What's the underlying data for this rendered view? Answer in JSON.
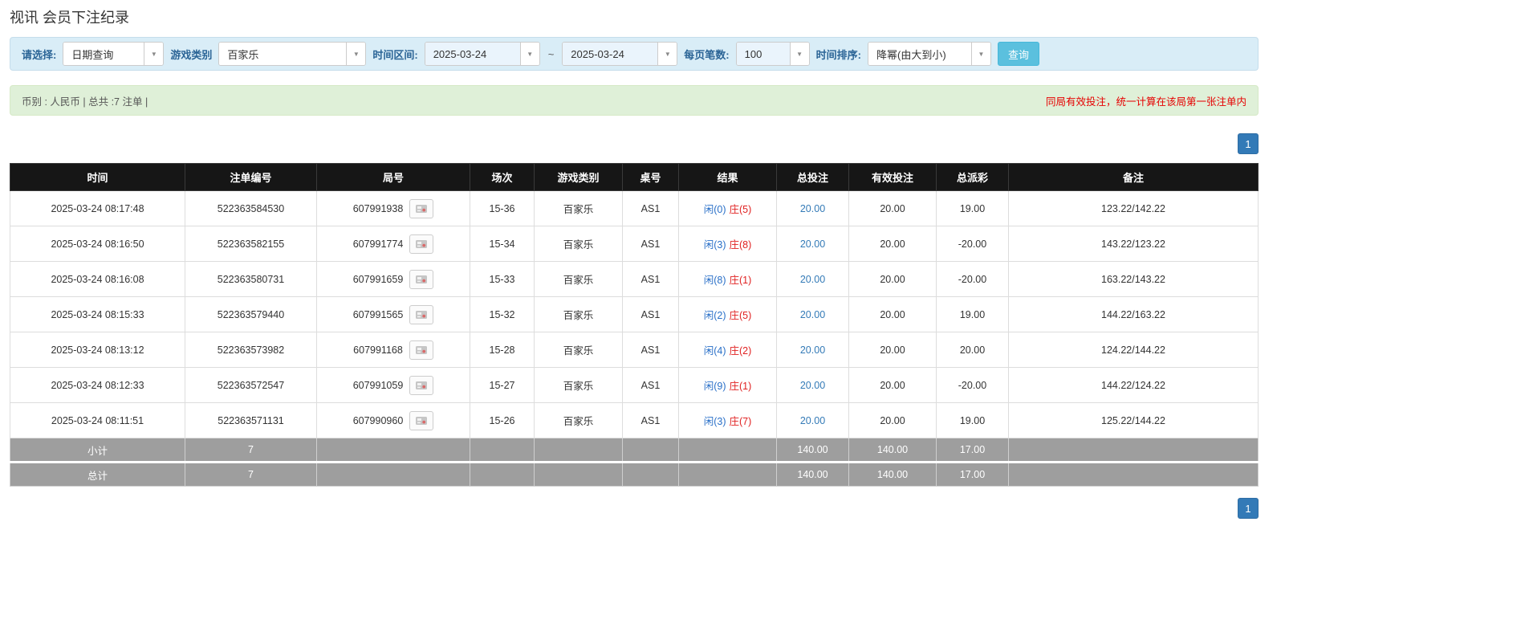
{
  "page": {
    "title": "视讯 会员下注纪录"
  },
  "colors": {
    "accent": "#337ab7",
    "query-button": "#5bc0de",
    "header-bg": "#161616",
    "summary-bg": "#9e9e9e",
    "filter-bg": "#d9edf7",
    "info-bg": "#dff0d8",
    "negative-red": "#e02020",
    "banker-red": "#e02020",
    "player-blue": "#2a70c8",
    "label-blue": "#2a6496",
    "notice-red": "#e60000"
  },
  "icons": {
    "dropdown_caret": "▼"
  },
  "filters": {
    "select_type": {
      "label": "请选择:",
      "value": "日期查询"
    },
    "game_type": {
      "label": "游戏类别",
      "value": "百家乐"
    },
    "date_range": {
      "label": "时间区间:",
      "from": "2025-03-24",
      "separator": "~",
      "to": "2025-03-24"
    },
    "page_size": {
      "label": "每页笔数:",
      "value": "100"
    },
    "sort": {
      "label": "时间排序:",
      "value": "降幂(由大到小)"
    },
    "query_button": "查询"
  },
  "info_bar": {
    "left": "币别 : 人民币 | 总共 :7 注单 |",
    "right": "同局有效投注，统一计算在该局第一张注单内"
  },
  "pagination": {
    "page": "1"
  },
  "table": {
    "headers": [
      "时间",
      "注单编号",
      "局号",
      "场次",
      "游戏类别",
      "桌号",
      "结果",
      "总投注",
      "有效投注",
      "总派彩",
      "备注"
    ],
    "rows": [
      {
        "time": "2025-03-24 08:17:48",
        "bet_id": "522363584530",
        "round_id": "607991938",
        "session": "15-36",
        "game": "百家乐",
        "table_no": "AS1",
        "result_player": "闲(0)",
        "result_banker": "庄(5)",
        "total_bet": "20.00",
        "valid_bet": "20.00",
        "payout": "19.00",
        "remark": "123.22/142.22"
      },
      {
        "time": "2025-03-24 08:16:50",
        "bet_id": "522363582155",
        "round_id": "607991774",
        "session": "15-34",
        "game": "百家乐",
        "table_no": "AS1",
        "result_player": "闲(3)",
        "result_banker": "庄(8)",
        "total_bet": "20.00",
        "valid_bet": "20.00",
        "payout": "-20.00",
        "remark": "143.22/123.22"
      },
      {
        "time": "2025-03-24 08:16:08",
        "bet_id": "522363580731",
        "round_id": "607991659",
        "session": "15-33",
        "game": "百家乐",
        "table_no": "AS1",
        "result_player": "闲(8)",
        "result_banker": "庄(1)",
        "total_bet": "20.00",
        "valid_bet": "20.00",
        "payout": "-20.00",
        "remark": "163.22/143.22"
      },
      {
        "time": "2025-03-24 08:15:33",
        "bet_id": "522363579440",
        "round_id": "607991565",
        "session": "15-32",
        "game": "百家乐",
        "table_no": "AS1",
        "result_player": "闲(2)",
        "result_banker": "庄(5)",
        "total_bet": "20.00",
        "valid_bet": "20.00",
        "payout": "19.00",
        "remark": "144.22/163.22"
      },
      {
        "time": "2025-03-24 08:13:12",
        "bet_id": "522363573982",
        "round_id": "607991168",
        "session": "15-28",
        "game": "百家乐",
        "table_no": "AS1",
        "result_player": "闲(4)",
        "result_banker": "庄(2)",
        "total_bet": "20.00",
        "valid_bet": "20.00",
        "payout": "20.00",
        "remark": "124.22/144.22"
      },
      {
        "time": "2025-03-24 08:12:33",
        "bet_id": "522363572547",
        "round_id": "607991059",
        "session": "15-27",
        "game": "百家乐",
        "table_no": "AS1",
        "result_player": "闲(9)",
        "result_banker": "庄(1)",
        "total_bet": "20.00",
        "valid_bet": "20.00",
        "payout": "-20.00",
        "remark": "144.22/124.22"
      },
      {
        "time": "2025-03-24 08:11:51",
        "bet_id": "522363571131",
        "round_id": "607990960",
        "session": "15-26",
        "game": "百家乐",
        "table_no": "AS1",
        "result_player": "闲(3)",
        "result_banker": "庄(7)",
        "total_bet": "20.00",
        "valid_bet": "20.00",
        "payout": "19.00",
        "remark": "125.22/144.22"
      }
    ],
    "subtotal": {
      "label": "小计",
      "count": "7",
      "total_bet": "140.00",
      "valid_bet": "140.00",
      "payout": "17.00"
    },
    "total": {
      "label": "总计",
      "count": "7",
      "total_bet": "140.00",
      "valid_bet": "140.00",
      "payout": "17.00"
    }
  }
}
